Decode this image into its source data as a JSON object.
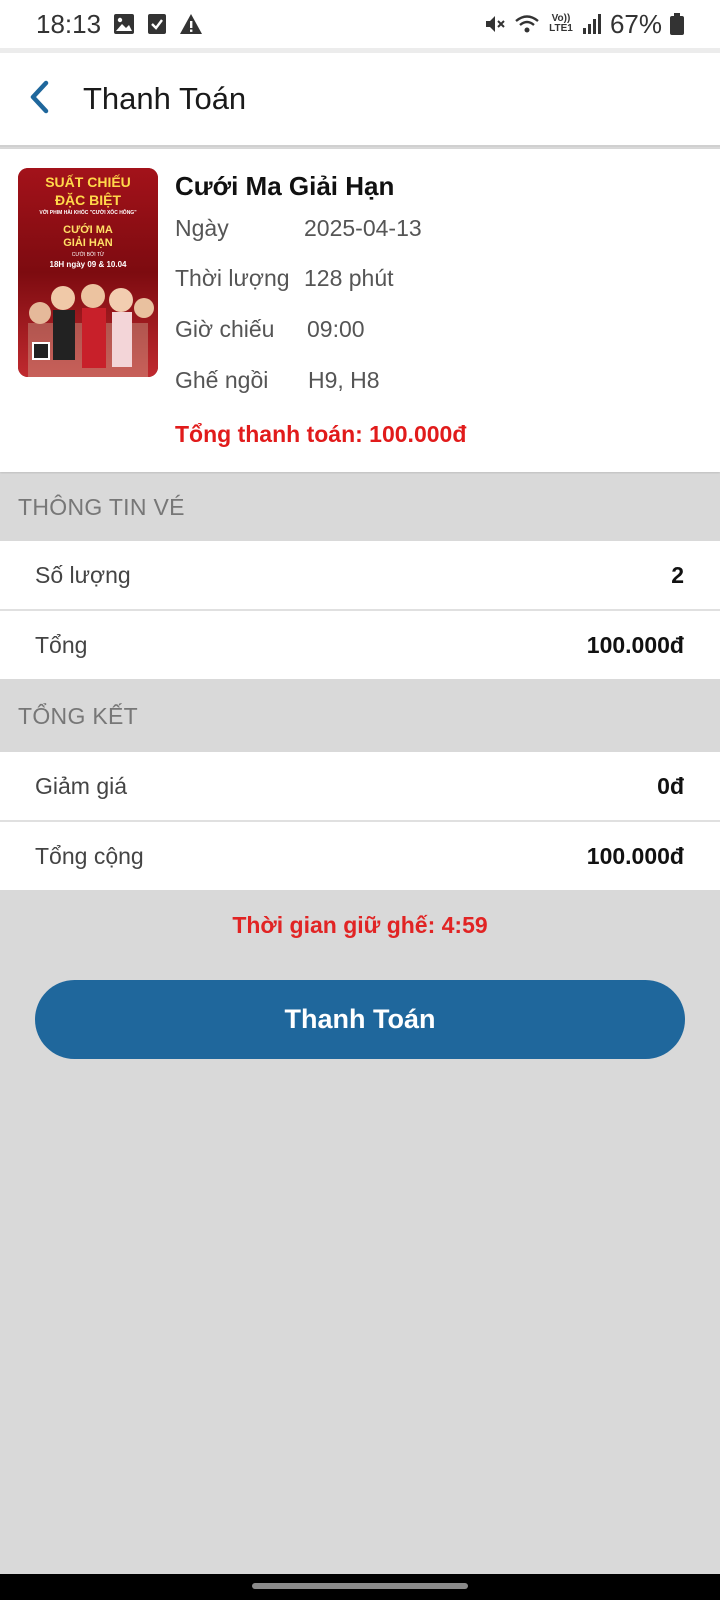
{
  "status_bar": {
    "time": "18:13",
    "left_icons": [
      "image-icon",
      "check-box-icon",
      "warning-icon"
    ],
    "right_icons": [
      "mute-icon",
      "wifi-icon",
      "volte-icon",
      "signal-icon",
      "battery-icon"
    ],
    "volte_text": "Vo)) LTE1",
    "battery": "67%"
  },
  "app_bar": {
    "title": "Thanh Toán"
  },
  "movie": {
    "title": "Cưới Ma Giải Hạn",
    "poster_lines": [
      "SUẤT CHIẾU",
      "ĐẶC BIỆT",
      "VỚI PHIM HÀI KHÓC \"CƯỜI XỐC HÔNG\"",
      "CƯỚI MA",
      "GIẢI HẠN",
      "CƯỚI BỞI TỪ",
      "18H ngày 09 & 10.04"
    ],
    "date_label": "Ngày",
    "date_value": "2025-04-13",
    "duration_label": "Thời lượng",
    "duration_value": "128 phút",
    "showtime_label": "Giờ chiếu",
    "showtime_value": "09:00",
    "seats_label": "Ghế ngồi",
    "seats_value": "H9, H8",
    "total_payment": "Tổng thanh toán: 100.000đ"
  },
  "ticket_info": {
    "header": "THÔNG TIN VÉ",
    "quantity_label": "Số lượng",
    "quantity_value": "2",
    "total_label": "Tổng",
    "total_value": "100.000đ"
  },
  "summary": {
    "header": "TỔNG KẾT",
    "discount_label": "Giảm giá",
    "discount_value": "0đ",
    "grand_total_label": "Tổng cộng",
    "grand_total_value": "100.000đ"
  },
  "hold_time": "Thời gian giữ ghế: 4:59",
  "pay_button": "Thanh Toán",
  "colors": {
    "accent": "#1f679c",
    "warning": "#e11b1b",
    "background": "#d9d9d9"
  }
}
